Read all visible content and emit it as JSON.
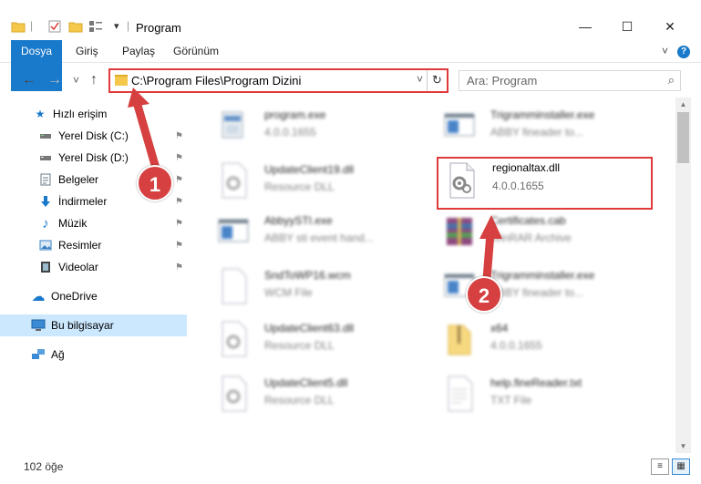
{
  "window": {
    "title": "Program",
    "minimize": "—",
    "maximize": "☐",
    "close": "✕"
  },
  "ribbon": {
    "tabs": [
      "Dosya",
      "Giriş",
      "Paylaş",
      "Görünüm"
    ],
    "help": "?",
    "collapse": "˅"
  },
  "nav": {
    "back": "←",
    "forward": "→",
    "recent": "˅",
    "up": "↑",
    "address": "C:\\Program Files\\Program Dizini",
    "address_chevron": "˅",
    "refresh": "↻",
    "search_placeholder": "Ara: Program",
    "search_icon": "⌕"
  },
  "sidebar": {
    "items": [
      {
        "label": "Hızlı erişim",
        "icon": "star-icon",
        "glyph": "★",
        "color": "#1979ca",
        "pinned": false
      },
      {
        "label": "Yerel Disk (C:)",
        "icon": "drive-icon",
        "glyph": "▬",
        "color": "#555555",
        "pinned": true
      },
      {
        "label": "Yerel Disk (D:)",
        "icon": "drive-icon",
        "glyph": "▬",
        "color": "#555555",
        "pinned": true
      },
      {
        "label": "Belgeler",
        "icon": "documents-icon",
        "glyph": "☷",
        "color": "#6a7a8a",
        "pinned": true
      },
      {
        "label": "İndirmeler",
        "icon": "downloads-icon",
        "glyph": "⬇",
        "color": "#1979ca",
        "pinned": true
      },
      {
        "label": "Müzik",
        "icon": "music-icon",
        "glyph": "♪",
        "color": "#1979ca",
        "pinned": true
      },
      {
        "label": "Resimler",
        "icon": "pictures-icon",
        "glyph": "▣",
        "color": "#3a7fc0",
        "pinned": true
      },
      {
        "label": "Videolar",
        "icon": "videos-icon",
        "glyph": "▦",
        "color": "#444444",
        "pinned": true
      },
      {
        "label": "OneDrive",
        "icon": "cloud-icon",
        "glyph": "☁",
        "color": "#1979ca",
        "pinned": false
      },
      {
        "label": "Bu bilgisayar",
        "icon": "computer-icon",
        "glyph": "▭",
        "color": "#1979ca",
        "pinned": false
      },
      {
        "label": "Ağ",
        "icon": "network-icon",
        "glyph": "☖",
        "color": "#1979ca",
        "pinned": false
      }
    ],
    "pin_glyph": "⚑"
  },
  "files": [
    {
      "name": "program.exe",
      "sub": "4.0.0.1655",
      "icon": "exe-icon"
    },
    {
      "name": "Trigramminstaller.exe",
      "sub": "ABBY fineader to...",
      "icon": "window-app-icon"
    },
    {
      "name": "UpdateClient19.dll",
      "sub": "Resource DLL",
      "icon": "dll-icon"
    },
    {
      "name": "regionaltax.dll",
      "sub": "4.0.0.1655",
      "icon": "dll-gear-icon"
    },
    {
      "name": "AbbyySTI.exe",
      "sub": "ABBY sti event hand...",
      "icon": "window-app-icon"
    },
    {
      "name": "Certificates.cab",
      "sub": "WinRAR Archive",
      "icon": "archive-icon"
    },
    {
      "name": "SndToWP16.wcm",
      "sub": "WCM File",
      "icon": "blank-file-icon"
    },
    {
      "name": "Trigramminstaller.exe",
      "sub": "ABBY fineader to...",
      "icon": "window-app-icon"
    },
    {
      "name": "UpdateClient63.dll",
      "sub": "Resource DLL",
      "icon": "dll-icon"
    },
    {
      "name": "x64",
      "sub": "4.0.0.1655",
      "icon": "folder-zip-icon"
    },
    {
      "name": "UpdateClient5.dll",
      "sub": "Resource DLL",
      "icon": "dll-icon"
    },
    {
      "name": "help.fineReader.txt",
      "sub": "TXT File",
      "icon": "text-file-icon"
    }
  ],
  "status": {
    "count": "102 öğe"
  },
  "callouts": [
    "1",
    "2"
  ],
  "colors": {
    "accent": "#1979ca",
    "highlight": "#e03a3a",
    "selected": "#cce8ff"
  }
}
